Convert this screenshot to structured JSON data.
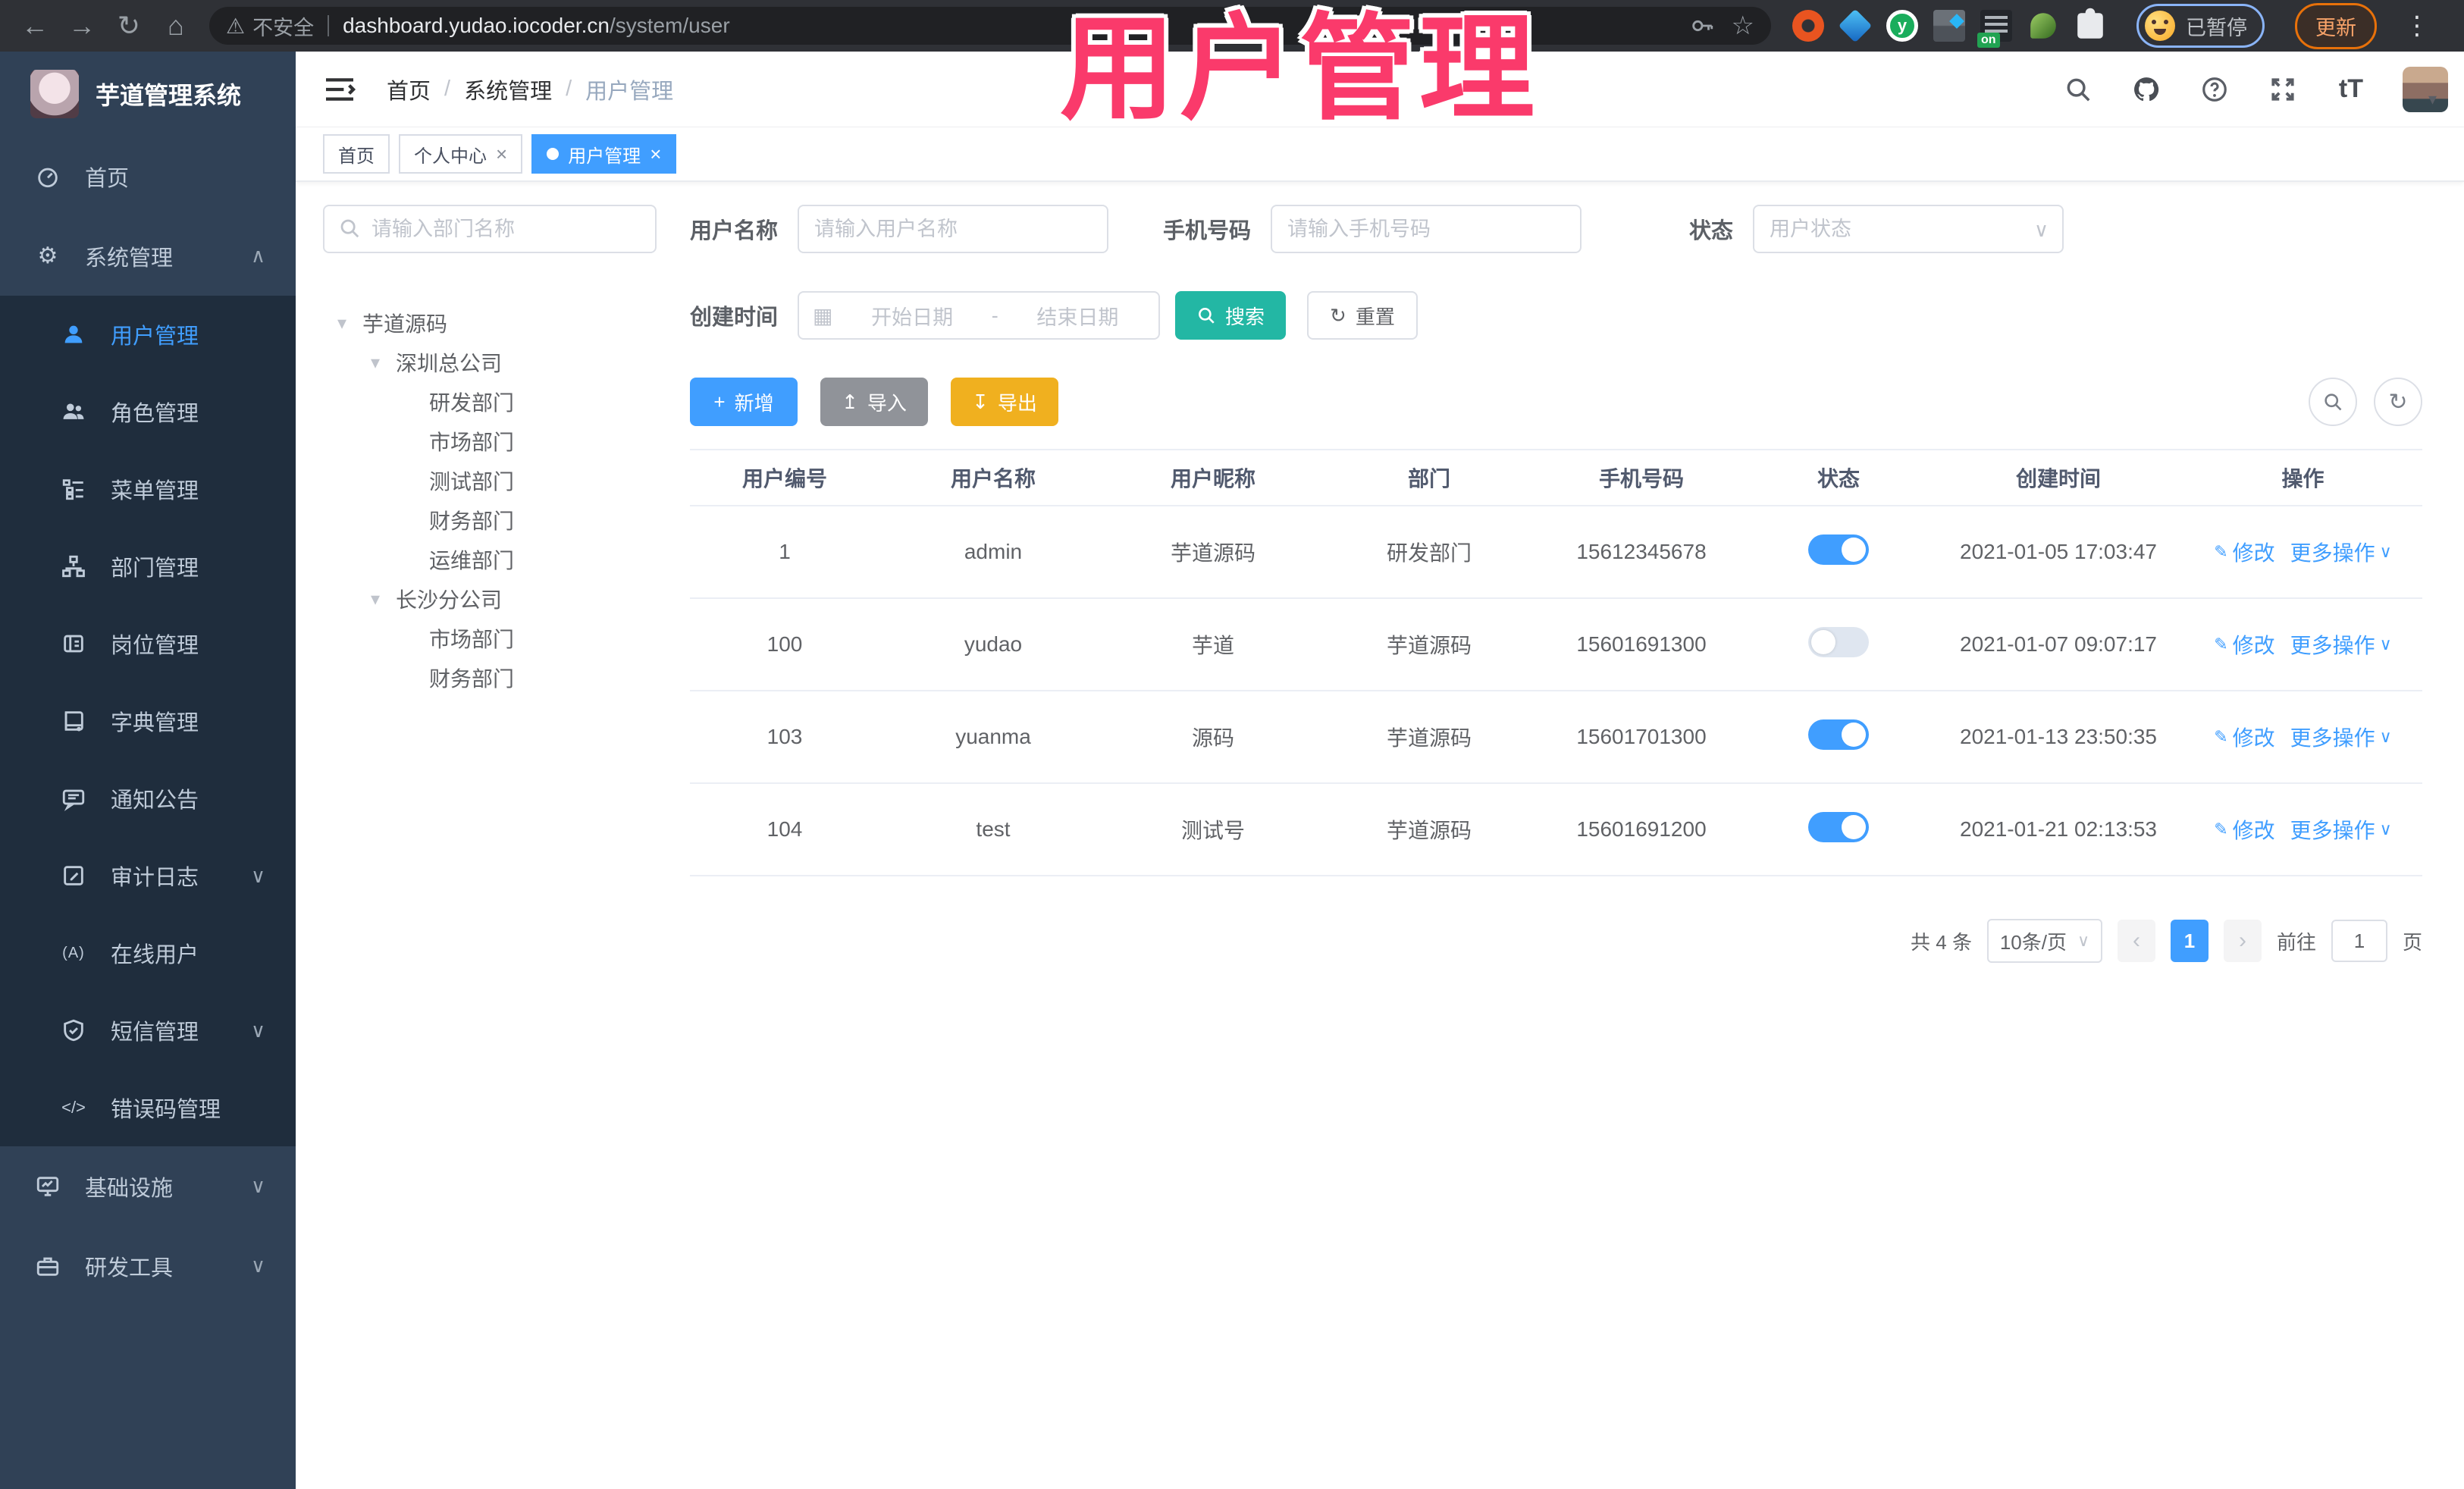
{
  "browser": {
    "security_label": "不安全",
    "url_host": "dashboard.yudao.iocoder.cn",
    "url_path": "/system/user",
    "paused_label": "已暂停",
    "update_label": "更新"
  },
  "annotation": {
    "text": "用户管理"
  },
  "sidebar": {
    "logo_title": "芋道管理系统",
    "items": [
      {
        "label": "首页"
      },
      {
        "label": "系统管理"
      },
      {
        "label": "用户管理"
      },
      {
        "label": "角色管理"
      },
      {
        "label": "菜单管理"
      },
      {
        "label": "部门管理"
      },
      {
        "label": "岗位管理"
      },
      {
        "label": "字典管理"
      },
      {
        "label": "通知公告"
      },
      {
        "label": "审计日志"
      },
      {
        "label": "在线用户"
      },
      {
        "label": "短信管理"
      },
      {
        "label": "错误码管理"
      },
      {
        "label": "基础设施"
      },
      {
        "label": "研发工具"
      }
    ]
  },
  "breadcrumb": {
    "items": [
      "首页",
      "系统管理",
      "用户管理"
    ],
    "separator": "/"
  },
  "tabs": [
    {
      "label": "首页"
    },
    {
      "label": "个人中心"
    },
    {
      "label": "用户管理"
    }
  ],
  "dept": {
    "search_placeholder": "请输入部门名称",
    "tree": [
      {
        "label": "芋道源码"
      },
      {
        "label": "深圳总公司"
      },
      {
        "label": "研发部门"
      },
      {
        "label": "市场部门"
      },
      {
        "label": "测试部门"
      },
      {
        "label": "财务部门"
      },
      {
        "label": "运维部门"
      },
      {
        "label": "长沙分公司"
      },
      {
        "label": "市场部门"
      },
      {
        "label": "财务部门"
      }
    ]
  },
  "filters": {
    "username_label": "用户名称",
    "username_placeholder": "请输入用户名称",
    "mobile_label": "手机号码",
    "mobile_placeholder": "请输入手机号码",
    "status_label": "状态",
    "status_placeholder": "用户状态",
    "created_label": "创建时间",
    "date_start_placeholder": "开始日期",
    "date_separator": "-",
    "date_end_placeholder": "结束日期",
    "search_label": "搜索",
    "reset_label": "重置"
  },
  "toolbar": {
    "add_label": "新增",
    "import_label": "导入",
    "export_label": "导出"
  },
  "table": {
    "columns": [
      "用户编号",
      "用户名称",
      "用户昵称",
      "部门",
      "手机号码",
      "状态",
      "创建时间",
      "操作"
    ],
    "actions": {
      "modify": "修改",
      "more": "更多操作"
    },
    "rows": [
      {
        "id": "1",
        "username": "admin",
        "nickname": "芋道源码",
        "dept": "研发部门",
        "mobile": "15612345678",
        "status": "on",
        "created": "2021-01-05 17:03:47"
      },
      {
        "id": "100",
        "username": "yudao",
        "nickname": "芋道",
        "dept": "芋道源码",
        "mobile": "15601691300",
        "status": "off",
        "created": "2021-01-07 09:07:17"
      },
      {
        "id": "103",
        "username": "yuanma",
        "nickname": "源码",
        "dept": "芋道源码",
        "mobile": "15601701300",
        "status": "on",
        "created": "2021-01-13 23:50:35"
      },
      {
        "id": "104",
        "username": "test",
        "nickname": "测试号",
        "dept": "芋道源码",
        "mobile": "15601691200",
        "status": "on",
        "created": "2021-01-21 02:13:53"
      }
    ]
  },
  "pagination": {
    "total_text": "共 4 条",
    "page_size": "10条/页",
    "current_page": "1",
    "goto_label": "前往",
    "goto_value": "1",
    "page_unit": "页"
  },
  "icons": {
    "back": "←",
    "forward": "→",
    "reload": "↻",
    "home": "⌂",
    "warning": "⚠",
    "star": "☆",
    "gear": "⚙",
    "caret_up": "∧",
    "caret_down": "∨",
    "tree_caret": "▾",
    "dot": "●",
    "close": "×",
    "calendar": "▦",
    "plus": "+",
    "upload": "↥",
    "download": "↧",
    "refresh": "↻",
    "edit": "✎",
    "code_glyph": "</>",
    "online_glyph": "(A)",
    "font_glyph": "tT",
    "more_dots": "⋮",
    "prev": "‹",
    "next": "›",
    "avatar_caret": "▾",
    "ext_y": "y"
  }
}
